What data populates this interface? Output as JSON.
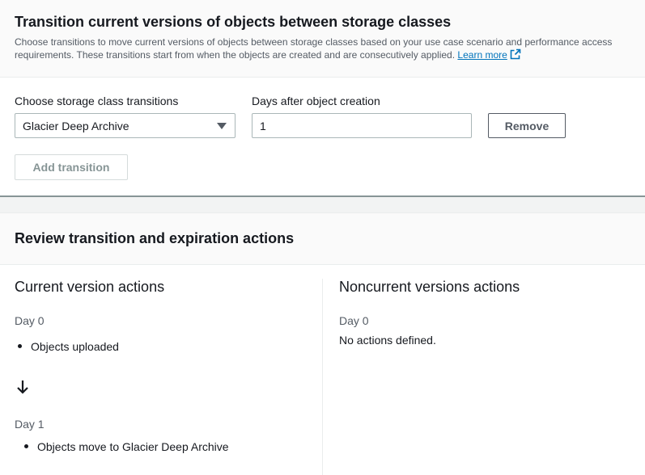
{
  "transition_section": {
    "title": "Transition current versions of objects between storage classes",
    "description": "Choose transitions to move current versions of objects between storage classes based on your use case scenario and performance access requirements. These transitions start from when the objects are created and are consecutively applied.",
    "learn_more_label": "Learn more",
    "storage_class_label": "Choose storage class transitions",
    "storage_class_value": "Glacier Deep Archive",
    "days_label": "Days after object creation",
    "days_value": "1",
    "remove_button": "Remove",
    "add_transition_button": "Add transition"
  },
  "review_section": {
    "title": "Review transition and expiration actions",
    "current": {
      "title": "Current version actions",
      "steps": [
        {
          "day": "Day 0",
          "action": "Objects uploaded"
        },
        {
          "day": "Day 1",
          "action": "Objects move to Glacier Deep Archive"
        }
      ]
    },
    "noncurrent": {
      "title": "Noncurrent versions actions",
      "day": "Day 0",
      "message": "No actions defined."
    }
  },
  "icons": {
    "external_link": "external-link-icon",
    "dropdown_caret": "caret-down-icon",
    "arrow_down": "arrow-down-icon"
  },
  "colors": {
    "link": "#0073bb",
    "text": "#16191f",
    "secondary_text": "#545b64",
    "disabled_text": "#879596"
  }
}
